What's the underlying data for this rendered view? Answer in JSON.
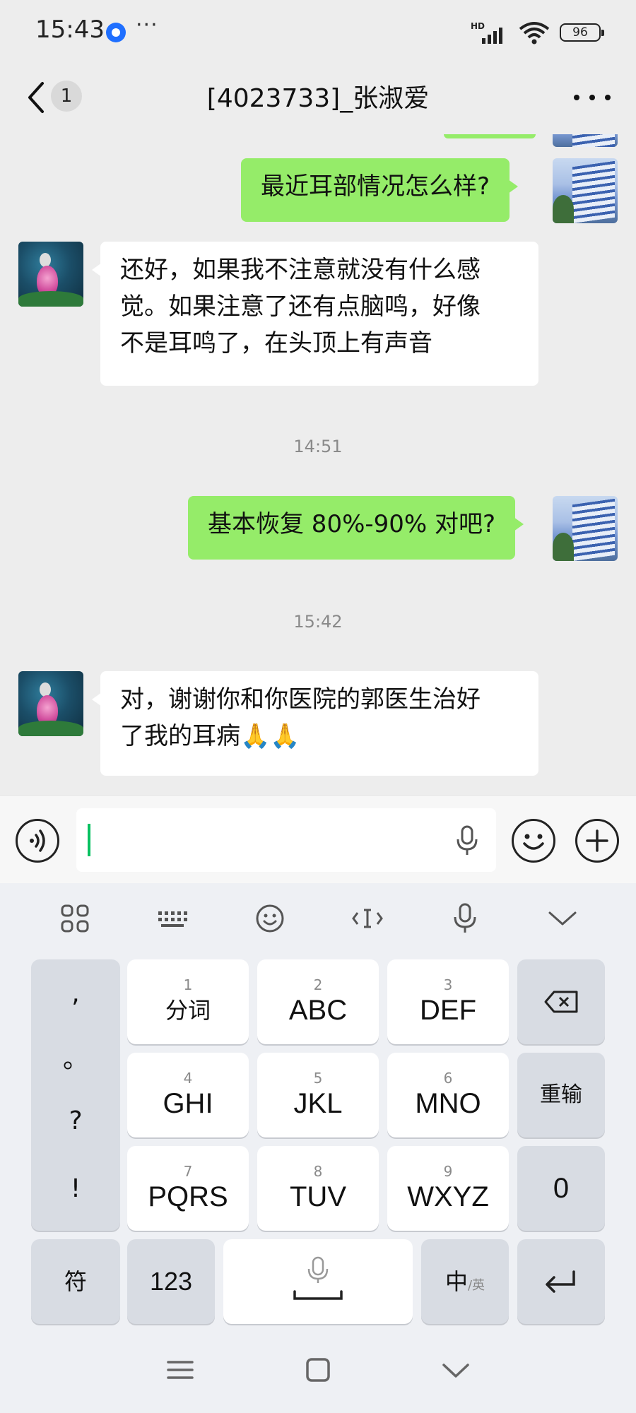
{
  "status_bar": {
    "time": "15:43",
    "more": "···",
    "signal_label": "HD",
    "battery": "96"
  },
  "header": {
    "unread_count": "1",
    "title": "[4023733]_张淑爱"
  },
  "messages": [
    {
      "type": "out",
      "text": "最近耳部情况怎么样?"
    },
    {
      "type": "in",
      "lines": [
        "还好，如果我不注意就没有什么感",
        "觉。如果注意了还有点脑鸣，好像",
        "不是耳鸣了，在头顶上有声音"
      ]
    },
    {
      "type": "time",
      "text": "14:51"
    },
    {
      "type": "out",
      "text": "基本恢复 80%-90% 对吧?"
    },
    {
      "type": "time",
      "text": "15:42"
    },
    {
      "type": "in",
      "lines": [
        "对，谢谢你和你医院的郭医生治好",
        "了我的耳病🙏🙏"
      ]
    }
  ],
  "input": {
    "value": ""
  },
  "keyboard": {
    "punctuation": [
      ",",
      "。",
      "?",
      "!"
    ],
    "keys": [
      {
        "num": "1",
        "label": "分词"
      },
      {
        "num": "2",
        "label": "ABC"
      },
      {
        "num": "3",
        "label": "DEF"
      },
      {
        "num": "4",
        "label": "GHI"
      },
      {
        "num": "5",
        "label": "JKL"
      },
      {
        "num": "6",
        "label": "MNO"
      },
      {
        "num": "7",
        "label": "PQRS"
      },
      {
        "num": "8",
        "label": "TUV"
      },
      {
        "num": "9",
        "label": "WXYZ"
      }
    ],
    "reinput_label": "重输",
    "zero_label": "0",
    "symbols_label": "符",
    "numbers_label": "123",
    "lang_label_main": "中",
    "lang_label_alt": "/英"
  },
  "colors": {
    "outgoing_bubble": "#95ec69",
    "incoming_bubble": "#ffffff",
    "background": "#ededed",
    "caret": "#07c160"
  },
  "icons": {
    "back": "chevron-left-icon",
    "more": "more-horizontal-icon",
    "voice": "voice-wave-icon",
    "emoji": "smile-icon",
    "plus": "plus-circle-icon",
    "mic": "microphone-icon",
    "backspace": "backspace-icon",
    "enter": "enter-icon",
    "menu": "menu-icon",
    "home": "home-square-icon",
    "nav_back": "chevron-down-icon"
  }
}
